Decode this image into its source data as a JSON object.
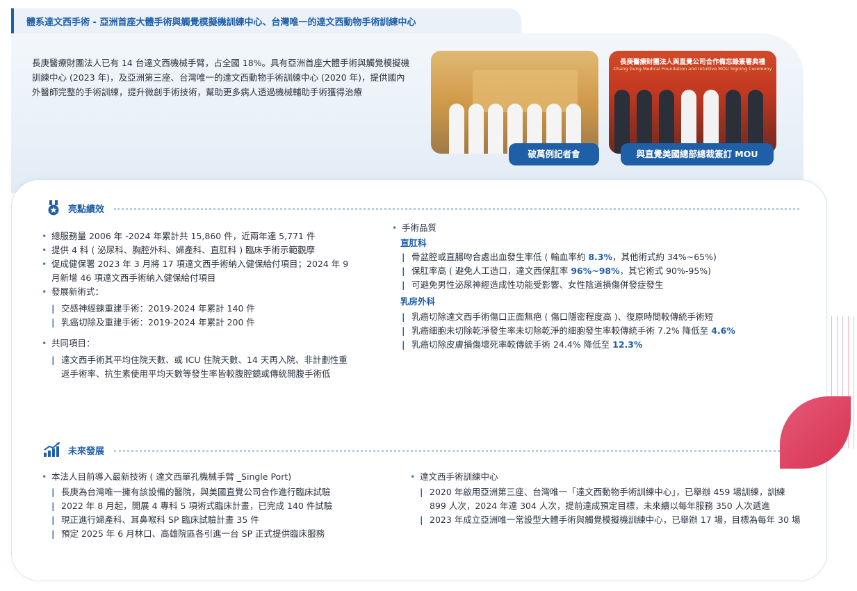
{
  "header": {
    "title": "體系達文西手術 - 亞洲首座大體手術與觸覺模擬機訓練中心、台灣唯一的達文西動物手術訓練中心"
  },
  "intro": {
    "text": "長庚醫療財團法人已有 14 台達文西機械手臂，占全國 18%。具有亞洲首座大體手術與觸覺模擬機訓練中心 (2023 年)，及亞洲第三座、台灣唯一的達文西動物手術訓練中心 (2020 年)，提供國內外醫師完整的手術訓練，提升微創手術技術，幫助更多病人透過機械輔助手術獲得治療"
  },
  "photos": {
    "photo1_label": "破萬例記者會",
    "photo2_label": "與直覺美國總部總裁簽訂 MOU",
    "photo2_banner": "長庚醫療財團法人與直覺公司合作備忘錄簽署典禮",
    "photo2_banner_sub": "Chang Gung Medical Foundation and Intuitive MOU Signing Ceremony"
  },
  "highlights": {
    "title": "亮點績效",
    "icon": "medal-icon",
    "left": {
      "items": [
        "總服務量 2006 年 -2024 年累計共 15,860 件，近兩年達 5,771 件",
        "提供 4 科 ( 泌尿科、胸腔外科、婦產科、直肛科 ) 臨床手術示範觀摩",
        "促成健保署 2023 年 3 月將 17 項達文西手術納入健保給付項目；2024 年 9 月新增 46 項達文西手術納入健保給付項目",
        "發展新術式："
      ],
      "new_techniques": [
        "交感神經鍊重建手術：2019-2024 年累計 140 件",
        "乳癌切除及重建手術：2019-2024 年累計 200 件"
      ],
      "common_label": "共同項目：",
      "common_text": "達文西手術其平均住院天數、或 ICU 住院天數、14 天再入院、非計劃性重返手術率、抗生素使用平均天數等發生率皆較腹腔鏡或傳統開腹手術低"
    },
    "right": {
      "quality_label": "手術品質",
      "rectal": {
        "title": "直肛科",
        "line1_pre": "骨盆腔或直腸吻合處出血發生率低 ( 輸血率約 ",
        "line1_hl": "8.3%",
        "line1_post": "，其他術式約 34%~65%)",
        "line2_pre": "保肛率高 ( 避免人工造口，達文西保肛率 ",
        "line2_hl": "96%~98%",
        "line2_post": "，其它術式 90%-95%)",
        "line3": "可避免男性泌尿神經造成性功能受影響、女性陰道損傷併發症發生"
      },
      "breast": {
        "title": "乳房外科",
        "line1": "乳癌切除達文西手術傷口正面無疤 ( 傷口隱密程度高 )、復原時間較傳統手術短",
        "line2_pre": "乳癌細胞未切除乾淨發生率未切除乾淨的細胞發生率較傳統手術 7.2% 降低至 ",
        "line2_hl": "4.6%",
        "line3_pre": "乳癌切除皮膚損傷壞死率較傳統手術 24.4% 降低至 ",
        "line3_hl": "12.3%"
      }
    }
  },
  "future": {
    "title": "未來發展",
    "icon": "growth-chart-icon",
    "left": {
      "head": "本法人目前導入最新技術 ( 達文西單孔機械手臂 _Single Port)",
      "items": [
        "長庚為台灣唯一擁有該設備的醫院，與美國直覺公司合作進行臨床試驗",
        "2022 年 8 月起，開展 4 專科 5 項術式臨床計畫，已完成 140 件試驗",
        "現正進行婦產科、耳鼻喉科 SP 臨床試驗計畫 35 件",
        "預定 2025 年 6 月林口、高雄院區各引進一台 SP 正式提供臨床服務"
      ]
    },
    "right": {
      "head": "達文西手術訓練中心",
      "items": [
        "2020 年啟用亞洲第三座、台灣唯一「達文西動物手術訓練中心」，已舉辦 459 場訓練，訓練 899 人次，2024 年達 304 人次，提前達成預定目標，未來續以每年服務 350 人次遞進",
        "2023 年成立亞洲唯一常設型大體手術與觸覺模擬機訓練中心，已舉辦 17 場，目標為每年 30 場"
      ]
    }
  },
  "colors": {
    "accent": "#1f5fa8",
    "decor_leaf": "#d83350"
  }
}
